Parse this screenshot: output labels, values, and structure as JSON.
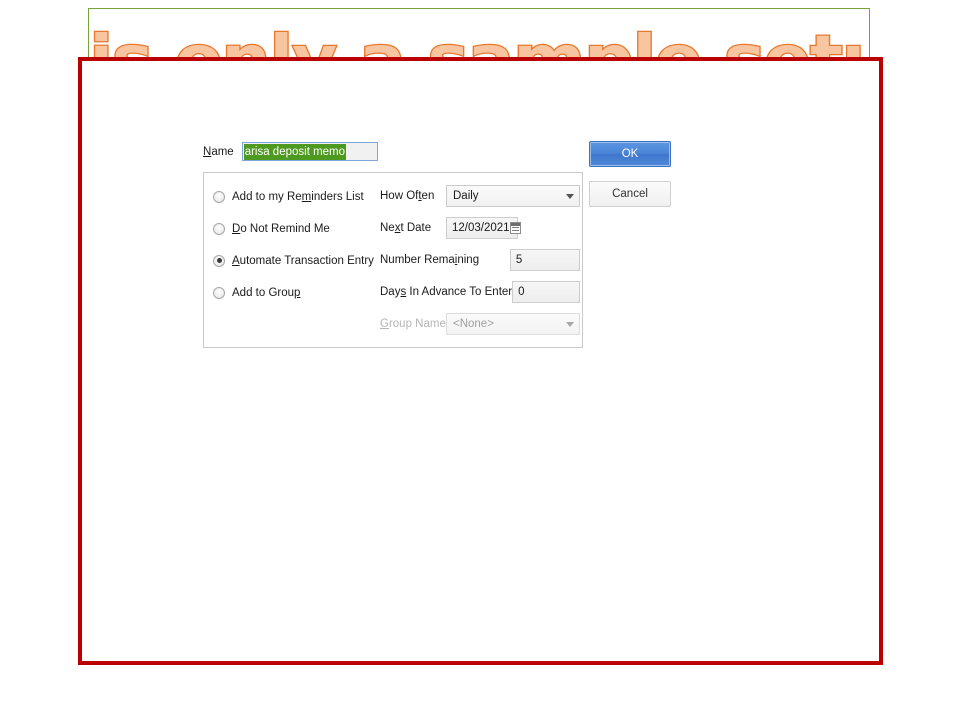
{
  "slide": {
    "title": "This only a sample setup.",
    "title_fill_color": "#F7C6A0",
    "title_outline_color": "#E8782D",
    "frame_color": "#BB0000",
    "title_box_border_color": "#77A33A",
    "background_color": "#FFFFFF"
  },
  "dialog": {
    "name": {
      "label": "Name",
      "label_accel": "N",
      "value": "arisa deposit memo",
      "selection_color": "#4E9A20"
    },
    "radio_options": [
      {
        "label": "Add to my Reminders List",
        "accel": "m",
        "selected": false
      },
      {
        "label": "Do Not Remind Me",
        "accel": "D",
        "selected": false
      },
      {
        "label": "Automate Transaction Entry",
        "accel": "A",
        "selected": true
      },
      {
        "label": "Add to Group",
        "accel": "p",
        "selected": false
      }
    ],
    "fields": {
      "how_often": {
        "label": "How Often",
        "accel": "t",
        "value": "Daily",
        "type": "dropdown",
        "disabled": false
      },
      "next_date": {
        "label": "Next Date",
        "accel": "x",
        "value": "12/03/2021",
        "type": "date",
        "icon": "calendar-icon",
        "disabled": false
      },
      "number_remaining": {
        "label": "Number Remaining",
        "accel": "i",
        "value": "5",
        "type": "number",
        "disabled": false
      },
      "days_in_advance": {
        "label": "Days In Advance To Enter",
        "accel": "s",
        "value": "0",
        "type": "number",
        "disabled": false
      },
      "group_name": {
        "label": "Group Name",
        "accel": "G",
        "value": "<None>",
        "type": "dropdown",
        "disabled": true
      }
    },
    "buttons": {
      "ok": "OK",
      "cancel": "Cancel",
      "ok_color": "#4B84D6"
    }
  }
}
